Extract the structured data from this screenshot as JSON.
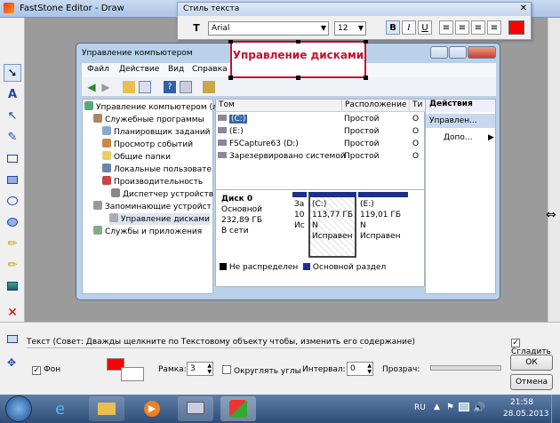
{
  "app": {
    "title": "FastStone Editor - Draw"
  },
  "text_style_toolbar": {
    "title": "Стиль текста",
    "font": "Arial",
    "size": "12",
    "bold": "B",
    "italic": "I",
    "underline": "U",
    "color": "#ff0000"
  },
  "cm_window": {
    "title": "Управление компьютером",
    "menu": [
      "Файл",
      "Действие",
      "Вид",
      "Справка"
    ],
    "tree": [
      "Управление компьютером (л",
      "Служебные программы",
      "Планировщик заданий",
      "Просмотр событий",
      "Общие папки",
      "Локальные пользовате",
      "Производительность",
      "Диспетчер устройств",
      "Запоминающие устройст",
      "Управление дисками",
      "Службы и приложения"
    ],
    "columns": [
      "Том",
      "Расположение",
      "Ти"
    ],
    "volumes": [
      {
        "name": "(C:)",
        "layout": "Простой",
        "type": "О"
      },
      {
        "name": "(E:)",
        "layout": "Простой",
        "type": "О"
      },
      {
        "name": "FSCapture63 (D:)",
        "layout": "Простой",
        "type": "О"
      },
      {
        "name": "Зарезервировано системой",
        "layout": "Простой",
        "type": "О"
      }
    ],
    "disk": {
      "name": "Диск 0",
      "kind": "Основной",
      "size": "232,89 ГБ",
      "status": "В сети"
    },
    "partitions": [
      {
        "lines": [
          "За",
          "10",
          "Ис"
        ]
      },
      {
        "lines": [
          "(C:)",
          "113,77 ГБ N",
          "Исправен"
        ]
      },
      {
        "lines": [
          "(E:)",
          "119,01 ГБ N",
          "Исправен"
        ]
      }
    ],
    "legend": [
      "Не распределен",
      "Основной раздел"
    ],
    "actions": {
      "header": "Действия",
      "item1": "Управлен...",
      "item2": "Допо..."
    }
  },
  "overlay_text": "Управление дисками",
  "bottom": {
    "hint": "Текст (Совет: Дважды щелкните по Текстовому объекту чтобы, изменить его содержание)",
    "fill_label": "Фон",
    "frame_label": "Рамка:",
    "frame_value": "3",
    "round_label": "Округлять углы",
    "interval_label": "Интервал:",
    "interval_value": "0",
    "opacity_label": "Прозрач:",
    "smooth_label": "Сгладить",
    "ok": "ОК",
    "cancel": "Отмена"
  },
  "taskbar": {
    "lang": "RU",
    "time": "21:58",
    "date": "28.05.2013"
  }
}
